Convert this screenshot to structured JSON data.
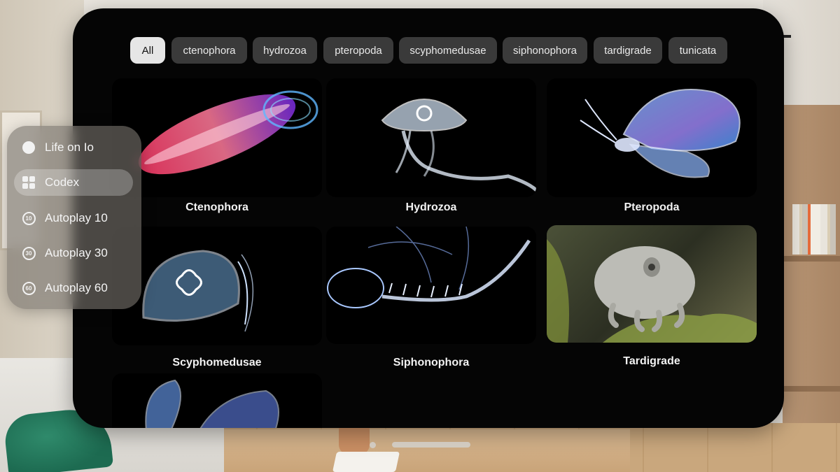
{
  "filters": [
    "All",
    "ctenophora",
    "hydrozoa",
    "pteropoda",
    "scyphomedusae",
    "siphonophora",
    "tardigrade",
    "tunicata"
  ],
  "active_filter": "All",
  "cards": [
    {
      "label": "Ctenophora"
    },
    {
      "label": "Hydrozoa"
    },
    {
      "label": "Pteropoda"
    },
    {
      "label": "Scyphomedusae"
    },
    {
      "label": "Siphonophora"
    },
    {
      "label": "Tardigrade"
    },
    {
      "label": ""
    }
  ],
  "sidebar": {
    "items": [
      {
        "label": "Life on Io",
        "icon": "circle-icon"
      },
      {
        "label": "Codex",
        "icon": "grid-icon",
        "active": true
      },
      {
        "label": "Autoplay 10",
        "icon": "timer-10-icon",
        "badge": "10"
      },
      {
        "label": "Autoplay 30",
        "icon": "timer-30-icon",
        "badge": "30"
      },
      {
        "label": "Autoplay 60",
        "icon": "timer-60-icon",
        "badge": "60"
      }
    ]
  }
}
